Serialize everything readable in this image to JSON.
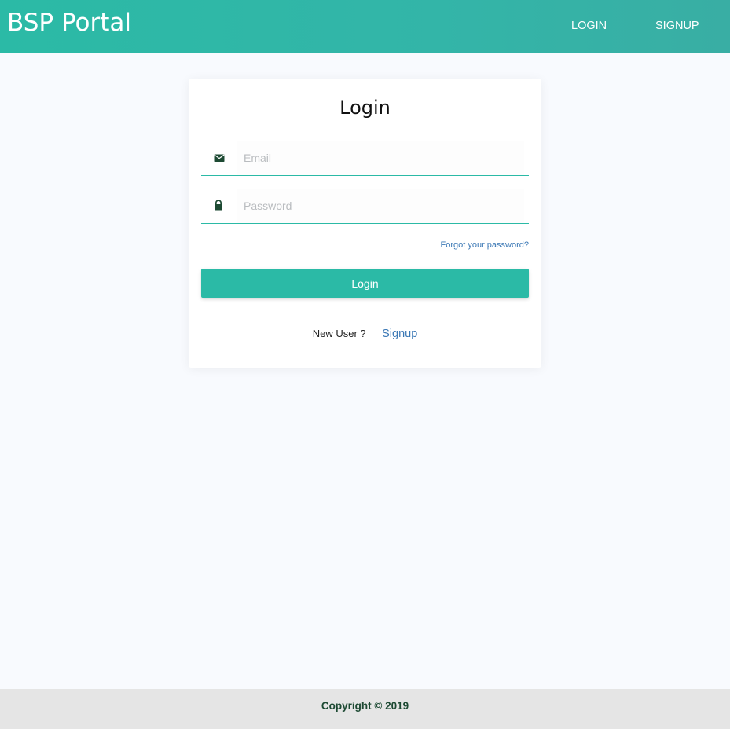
{
  "header": {
    "brand": "BSP Portal",
    "nav": {
      "login_label": "LOGIN",
      "signup_label": "SIGNUP"
    }
  },
  "login_card": {
    "title": "Login",
    "email": {
      "placeholder": "Email",
      "value": "",
      "icon": "envelope-icon"
    },
    "password": {
      "placeholder": "Password",
      "value": "",
      "icon": "lock-icon"
    },
    "forgot_label": "Forgot your password?",
    "submit_label": "Login",
    "new_user_label": "New User ?",
    "signup_label": "Signup"
  },
  "footer": {
    "copyright": "Copyright © 2019"
  },
  "colors": {
    "accent": "#2bbaa6",
    "link": "#3b78b5",
    "icon": "#1d4a33",
    "page_bg": "#f8fafe",
    "footer_bg": "#e5e5e5"
  }
}
